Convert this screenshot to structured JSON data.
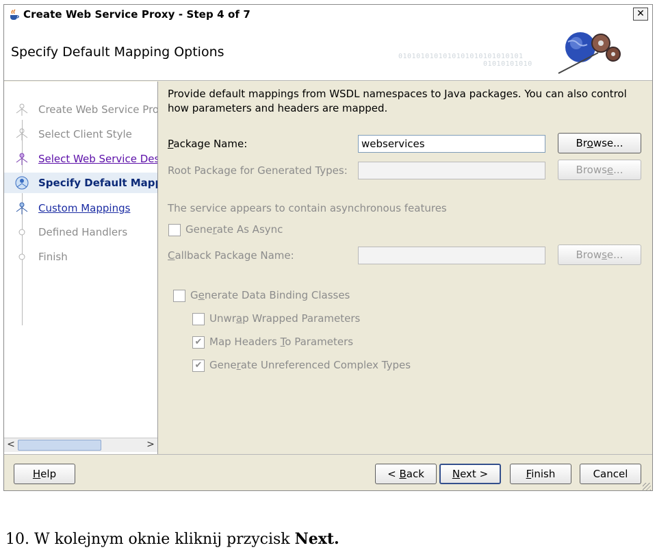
{
  "window": {
    "title": "Create Web Service Proxy - Step 4 of 7",
    "close_label": "✕"
  },
  "header": {
    "title": "Specify Default Mapping Options",
    "binary_text_1": "0101010101010101010101010101",
    "binary_text_2": "01010101010"
  },
  "nav": {
    "items": [
      {
        "label": "Create Web Service Pro",
        "state": "disabled"
      },
      {
        "label": "Select Client Style",
        "state": "disabled"
      },
      {
        "label": "Select Web Service Desc",
        "state": "visited"
      },
      {
        "label": "Specify Default Mapp",
        "state": "current"
      },
      {
        "label": "Custom Mappings",
        "state": "link"
      },
      {
        "label": "Defined Handlers",
        "state": "disabled"
      },
      {
        "label": "Finish",
        "state": "disabled"
      }
    ],
    "scroll_left": "<",
    "scroll_right": ">"
  },
  "content": {
    "intro": "Provide default mappings from WSDL namespaces to Java packages. You can also control how parameters and headers are mapped.",
    "package_name": {
      "label_first": "P",
      "label_rest": "ackage Name:",
      "value": "webservices",
      "browse_pre": "Br",
      "browse_u": "o",
      "browse_post": "wse..."
    },
    "root_package": {
      "label_pre": "Root Packa",
      "label_u": "g",
      "label_post": "e for Generated Types:",
      "value": "",
      "browse_pre": "Brows",
      "browse_u": "e",
      "browse_post": "..."
    },
    "async_note": "The service appears to contain asynchronous features",
    "generate_async": {
      "label_pre": "Gene",
      "label_u": "r",
      "label_post": "ate As Async",
      "checked": false
    },
    "callback": {
      "label_first": "C",
      "label_rest": "allback Package Name:",
      "value": "",
      "browse_pre": "Brow",
      "browse_u": "s",
      "browse_post": "e..."
    },
    "data_binding": {
      "label_pre": "G",
      "label_u": "e",
      "label_post": "nerate Data Binding Classes",
      "checked": false
    },
    "unwrap": {
      "label_pre": "Unwr",
      "label_u": "a",
      "label_post": "p Wrapped Parameters",
      "checked": false
    },
    "map_headers": {
      "label_pre": "Map Headers ",
      "label_u": "T",
      "label_post": "o Parameters",
      "checked": true
    },
    "unreferenced": {
      "label_pre": "Gene",
      "label_u": "r",
      "label_post": "ate Unreferenced Complex Types",
      "checked": true
    },
    "check_mark": "✔"
  },
  "footer": {
    "help": {
      "u": "H",
      "rest": "elp"
    },
    "back": {
      "pre": "< ",
      "u": "B",
      "rest": "ack"
    },
    "next": {
      "u": "N",
      "rest": "ext >"
    },
    "finish": {
      "u": "F",
      "rest": "inish"
    },
    "cancel": "Cancel"
  },
  "caption": {
    "text": "10. W kolejnym oknie kliknij przycisk ",
    "bold": "Next."
  },
  "colors": {
    "dialog_bg": "#ece9d8",
    "visited_link": "#5b0ea8",
    "current_step": "#0c2a78",
    "disabled_text": "#8c8c8c"
  }
}
